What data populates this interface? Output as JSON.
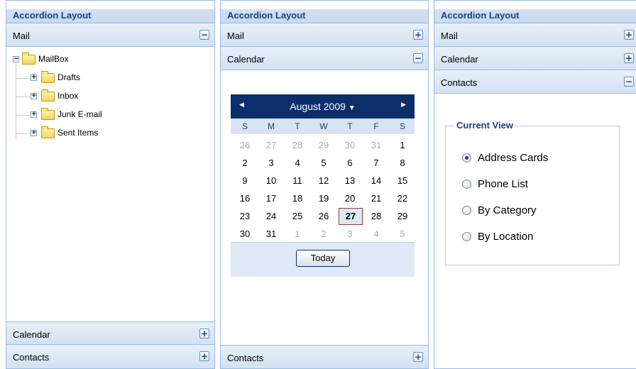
{
  "panel1": {
    "title": "Accordion Layout",
    "sections": [
      "Mail",
      "Calendar",
      "Contacts"
    ],
    "tree": {
      "root": "MailBox",
      "children": [
        "Drafts",
        "Inbox",
        "Junk E-mail",
        "Sent Items"
      ]
    }
  },
  "panel2": {
    "title": "Accordion Layout",
    "sections": [
      "Mail",
      "Calendar",
      "Contacts"
    ],
    "calendar": {
      "month_label": "August 2009",
      "dow": [
        "S",
        "M",
        "T",
        "W",
        "T",
        "F",
        "S"
      ],
      "weeks": [
        [
          "26",
          "27",
          "28",
          "29",
          "30",
          "31",
          "1"
        ],
        [
          "2",
          "3",
          "4",
          "5",
          "6",
          "7",
          "8"
        ],
        [
          "9",
          "10",
          "11",
          "12",
          "13",
          "14",
          "15"
        ],
        [
          "16",
          "17",
          "18",
          "19",
          "20",
          "21",
          "22"
        ],
        [
          "23",
          "24",
          "25",
          "26",
          "27",
          "28",
          "29"
        ],
        [
          "30",
          "31",
          "1",
          "2",
          "3",
          "4",
          "5"
        ]
      ],
      "selected": "27",
      "today_label": "Today"
    }
  },
  "panel3": {
    "title": "Accordion Layout",
    "sections": [
      "Mail",
      "Calendar",
      "Contacts"
    ],
    "view": {
      "legend": "Current View",
      "options": [
        "Address Cards",
        "Phone List",
        "By Category",
        "By Location"
      ],
      "selected_index": 0
    }
  },
  "colors": {
    "title_text": "#15428b",
    "header_border": "#99bbe8",
    "calendar_header": "#0b2e6b"
  }
}
